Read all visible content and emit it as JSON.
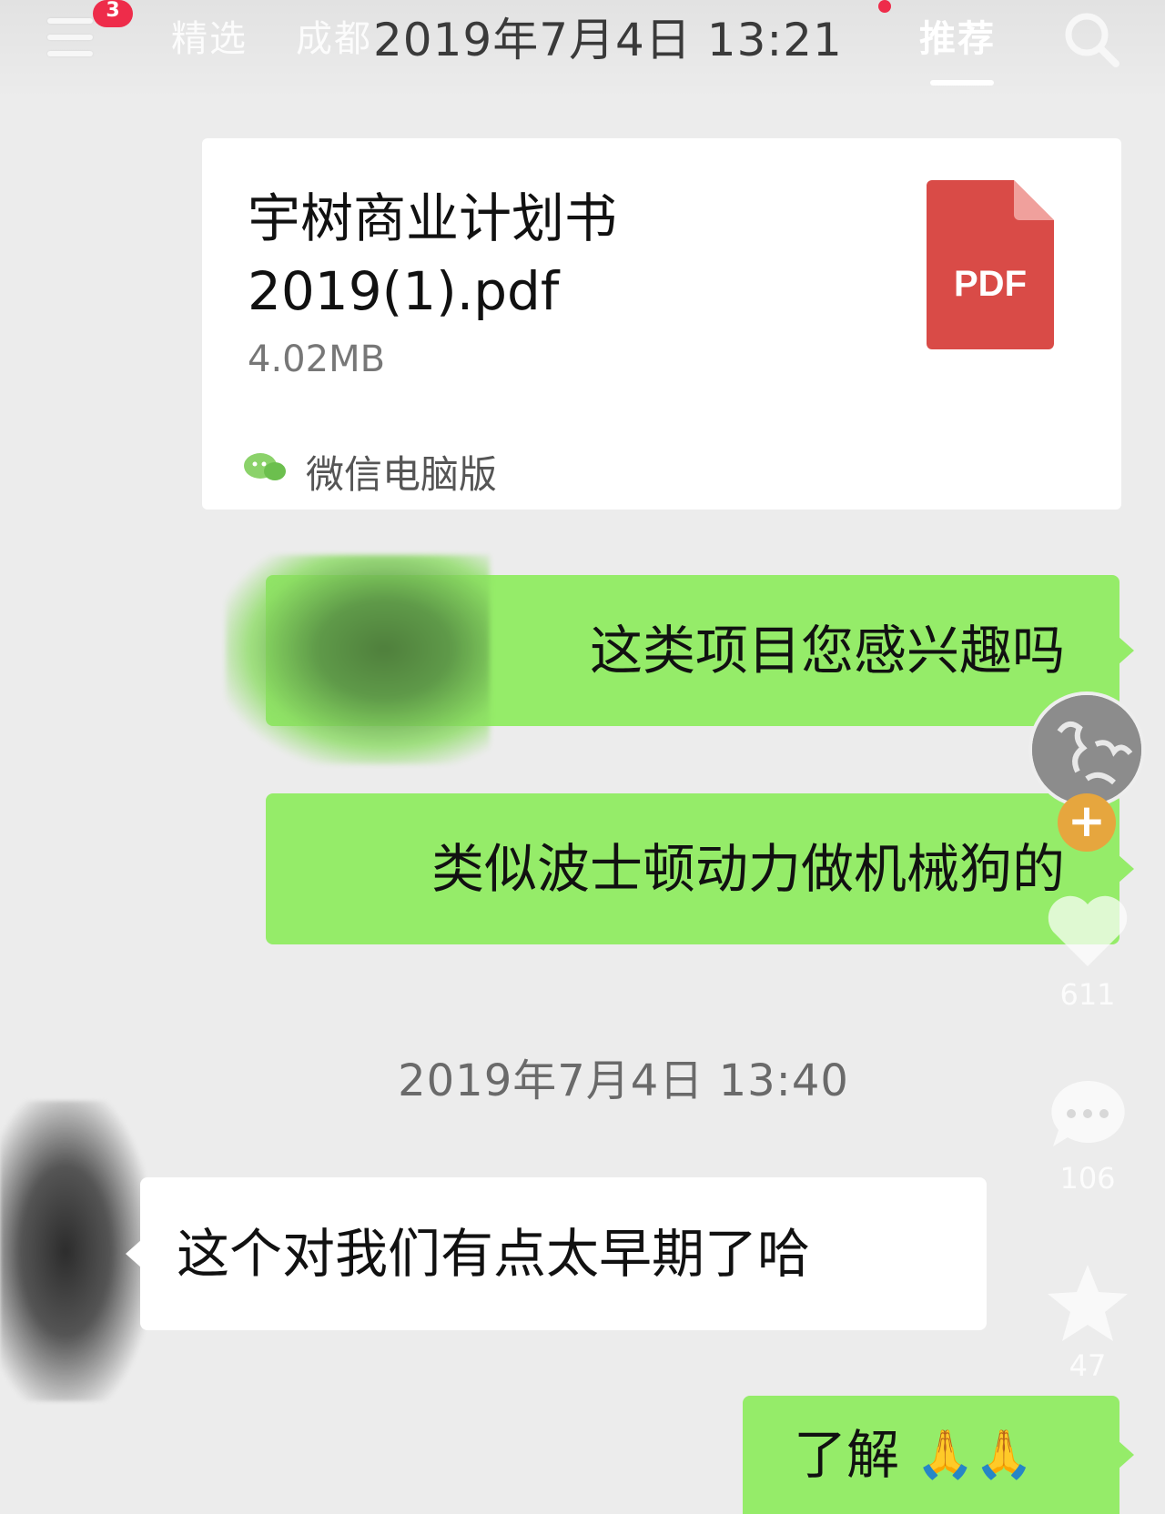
{
  "top_nav": {
    "menu_badge": "3",
    "tabs": {
      "featured": "精选",
      "local": "成都",
      "recommend": "推荐"
    },
    "chat_time_overlay": "2019年7月4日 13:21"
  },
  "chat": {
    "file_card": {
      "file_name": "宇树商业计划书2019(1).pdf",
      "file_size": "4.02MB",
      "file_type_label": "PDF",
      "source": "微信电脑版",
      "icon": "pdf-icon"
    },
    "messages": [
      {
        "from": "me",
        "text": "这类项目您感兴趣吗"
      },
      {
        "from": "me",
        "text": "类似波士顿动力做机械狗的"
      },
      {
        "from": "them",
        "text": "这个对我们有点太早期了哈"
      },
      {
        "from": "me",
        "text": "了解"
      }
    ],
    "time_divider": "2019年7月4日 13:40"
  },
  "side_actions": {
    "follow": "+",
    "likes": "611",
    "comments": "106",
    "favorites": "47"
  },
  "colors": {
    "bubble_me": "#95ec69",
    "bubble_them": "#ffffff",
    "pdf_red": "#d94b47",
    "badge_red": "#ee2c4a",
    "follow_orange": "#e6a63e"
  }
}
